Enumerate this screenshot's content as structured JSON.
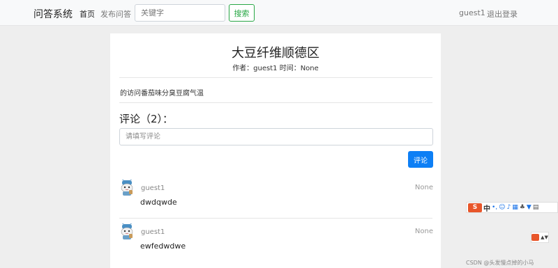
{
  "navbar": {
    "brand": "问答系统",
    "home": "首页",
    "publish": "发布问答",
    "search_placeholder": "关键字",
    "search_button": "搜索",
    "user": "guest1",
    "logout": "退出登录"
  },
  "post": {
    "title": "大豆纤维顺德区",
    "meta": "作者：guest1 时间：None",
    "content": "的访问番茄味分臭豆腐气温"
  },
  "comments_section": {
    "heading": "评论（2）：",
    "placeholder": "请填写评论",
    "submit_label": "评论",
    "items": [
      {
        "author": "guest1",
        "time": "None",
        "text": "dwdqwde"
      },
      {
        "author": "guest1",
        "time": "None",
        "text": "ewfedwdwe"
      }
    ]
  },
  "ime": {
    "logo": "S",
    "lang": "中"
  },
  "watermark": "CSDN @头发慢点掉的小马"
}
